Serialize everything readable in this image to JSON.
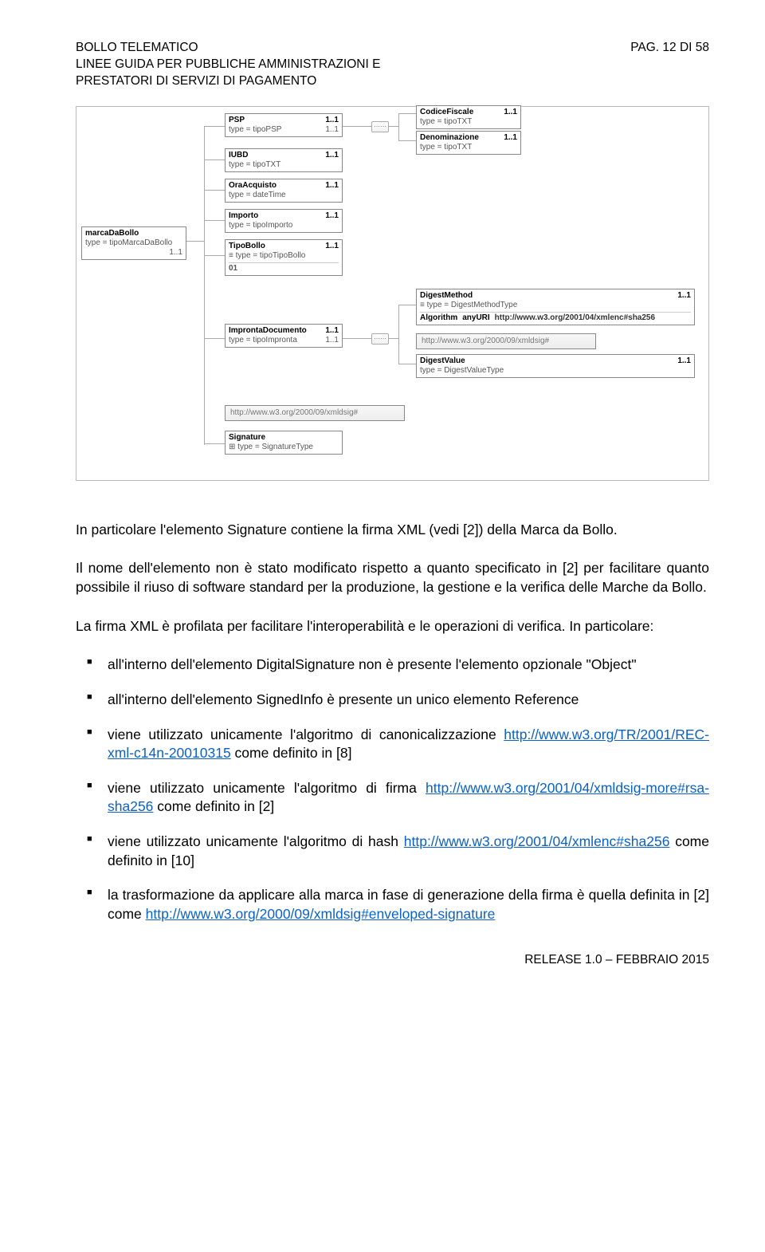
{
  "header": {
    "title1": "BOLLO TELEMATICO",
    "title2": "LINEE GUIDA PER PUBBLICHE AMMINISTRAZIONI E",
    "title3": "PRESTATORI DI SERVIZI DI PAGAMENTO",
    "page_left": "PAG. ",
    "page_mid": "12",
    "page_right": " DI 58"
  },
  "diagram": {
    "marcaDaBollo": {
      "name": "marcaDaBollo",
      "type": "type = tipoMarcaDaBollo",
      "mult": "1..1"
    },
    "psp": {
      "name": "PSP",
      "type": "type = tipoPSP",
      "mult": "1..1",
      "mult2": "1..1"
    },
    "codiceFiscale": {
      "name": "CodiceFiscale",
      "type": "type = tipoTXT",
      "mult": "1..1"
    },
    "denominazione": {
      "name": "Denominazione",
      "type": "type = tipoTXT",
      "mult": "1..1"
    },
    "iubd": {
      "name": "IUBD",
      "type": "type = tipoTXT",
      "mult": "1..1"
    },
    "oraAcquisto": {
      "name": "OraAcquisto",
      "type": "type = dateTime",
      "mult": "1..1"
    },
    "importo": {
      "name": "Importo",
      "type": "type = tipoImporto",
      "mult": "1..1"
    },
    "tipoBollo": {
      "name": "TipoBollo",
      "type": "type = tipoTipoBollo",
      "mult": "1..1",
      "val": "01",
      "marker": "≡"
    },
    "improntaDoc": {
      "name": "ImprontaDocumento",
      "type": "type = tipoImpronta",
      "mult": "1..1",
      "mult2": "1..1"
    },
    "digestMethod": {
      "name": "DigestMethod",
      "type": "type = DigestMethodType",
      "mult": "1..1",
      "marker": "≡",
      "algLabel": "Algorithm",
      "algType": "anyURI",
      "algVal": "http://www.w3.org/2001/04/xmlenc#sha256"
    },
    "digestValue": {
      "name": "DigestValue",
      "type": "type = DigestValueType",
      "mult": "1..1"
    },
    "url1": "http://www.w3.org/2000/09/xmldsig#",
    "url2": "http://www.w3.org/2000/09/xmldsig#",
    "signature": {
      "name": "Signature",
      "type": "type = SignatureType",
      "marker": "⊞"
    },
    "chip": "⋯⋯"
  },
  "body": {
    "p1": "In particolare l'elemento Signature contiene la firma XML (vedi [2]) della Marca da Bollo.",
    "p2": "Il nome dell'elemento non è stato modificato rispetto a quanto specificato in [2] per facilitare quanto possibile il riuso di software standard per la produzione, la gestione e la verifica delle Marche da Bollo.",
    "p3": "La firma XML è profilata per facilitare l'interoperabilità e le operazioni di verifica. In particolare:",
    "li1": "all'interno dell'elemento DigitalSignature non è presente l'elemento opzionale \"Object\"",
    "li2": "all'interno dell'elemento SignedInfo è presente un unico elemento Reference",
    "li3a": "viene utilizzato unicamente l'algoritmo di canonicalizzazione ",
    "li3link": "http://www.w3.org/TR/2001/REC-xml-c14n-20010315",
    "li3b": " come definito in [8]",
    "li4a": "viene utilizzato unicamente l'algoritmo di firma ",
    "li4link": "http://www.w3.org/2001/04/xmldsig-more#rsa-sha256",
    "li4b": " come definito in [2]",
    "li5a": "viene utilizzato unicamente l'algoritmo di hash ",
    "li5link": "http://www.w3.org/2001/04/xmlenc#sha256",
    "li5b": " come definito in [10]",
    "li6a": "la trasformazione da applicare alla marca in fase di generazione della firma è quella definita in [2] come ",
    "li6link": "http://www.w3.org/2000/09/xmldsig#enveloped-signature"
  },
  "footer": {
    "text": "RELEASE 1.0 – FEBBRAIO 2015"
  }
}
